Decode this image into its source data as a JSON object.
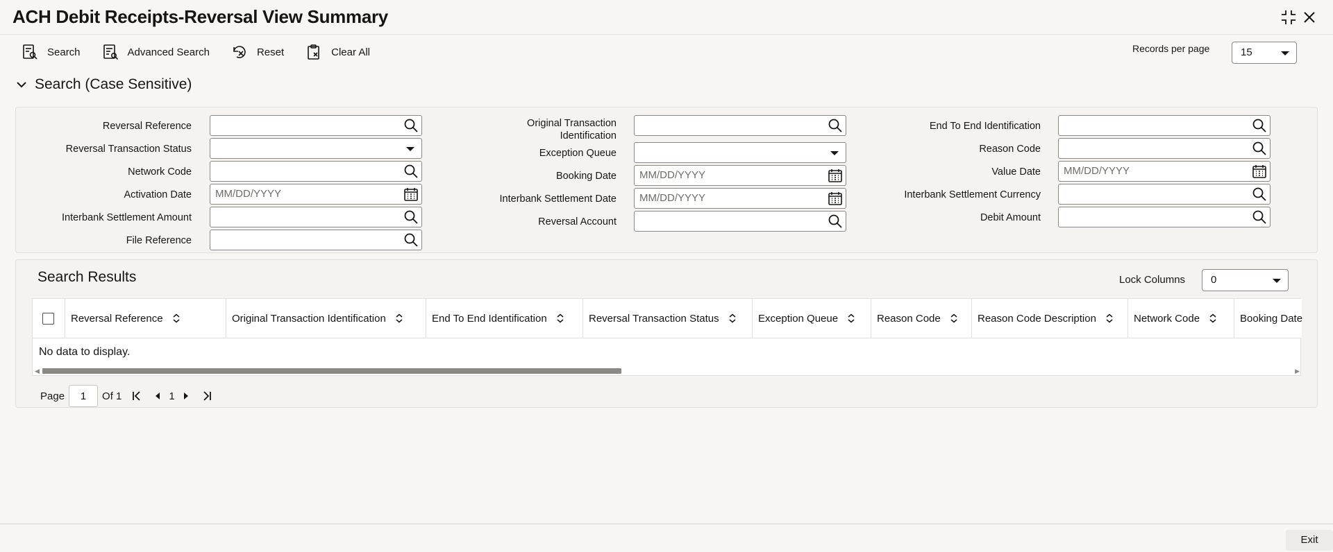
{
  "window": {
    "title": "ACH Debit Receipts-Reversal View Summary",
    "minimize_icon": "collapse-icon",
    "close_icon": "close-icon"
  },
  "toolbar": {
    "search_label": "Search",
    "advanced_search_label": "Advanced Search",
    "reset_label": "Reset",
    "clear_all_label": "Clear All"
  },
  "records_per_page": {
    "label": "Records per page",
    "value": "15"
  },
  "search_section": {
    "title": "Search (Case Sensitive)",
    "fields": {
      "reversal_reference": {
        "label": "Reversal Reference",
        "value": ""
      },
      "reversal_transaction_status": {
        "label": "Reversal Transaction Status",
        "value": ""
      },
      "network_code": {
        "label": "Network Code",
        "value": ""
      },
      "activation_date": {
        "label": "Activation Date",
        "placeholder": "MM/DD/YYYY"
      },
      "interbank_settlement_amount": {
        "label": "Interbank Settlement Amount",
        "value": ""
      },
      "file_reference": {
        "label": "File Reference",
        "value": ""
      },
      "original_transaction_identification": {
        "label_line1": "Original Transaction",
        "label_line2": "Identification",
        "value": ""
      },
      "exception_queue": {
        "label": "Exception Queue",
        "value": ""
      },
      "booking_date": {
        "label": "Booking Date",
        "placeholder": "MM/DD/YYYY"
      },
      "interbank_settlement_date": {
        "label": "Interbank Settlement Date",
        "placeholder": "MM/DD/YYYY"
      },
      "reversal_account": {
        "label": "Reversal Account",
        "value": ""
      },
      "end_to_end_identification": {
        "label": "End To End Identification",
        "value": ""
      },
      "reason_code": {
        "label": "Reason Code",
        "value": ""
      },
      "value_date": {
        "label": "Value Date",
        "placeholder": "MM/DD/YYYY"
      },
      "interbank_settlement_currency": {
        "label": "Interbank Settlement Currency",
        "value": ""
      },
      "debit_amount": {
        "label": "Debit Amount",
        "value": ""
      }
    }
  },
  "results": {
    "title": "Search Results",
    "lock_columns": {
      "label": "Lock Columns",
      "value": "0"
    },
    "columns": [
      "Reversal Reference",
      "Original Transaction Identification",
      "End To End Identification",
      "Reversal Transaction Status",
      "Exception Queue",
      "Reason Code",
      "Reason Code Description",
      "Network Code",
      "Booking Date"
    ],
    "empty_message": "No data to display."
  },
  "pagination": {
    "page_label": "Page",
    "current_page": "1",
    "of_label": "Of 1",
    "page_link": "1"
  },
  "footer": {
    "exit_label": "Exit"
  },
  "colors": {
    "background": "#f7f6f4",
    "panel": "#f4f3f1",
    "border": "#8b8985",
    "text": "#161513"
  }
}
